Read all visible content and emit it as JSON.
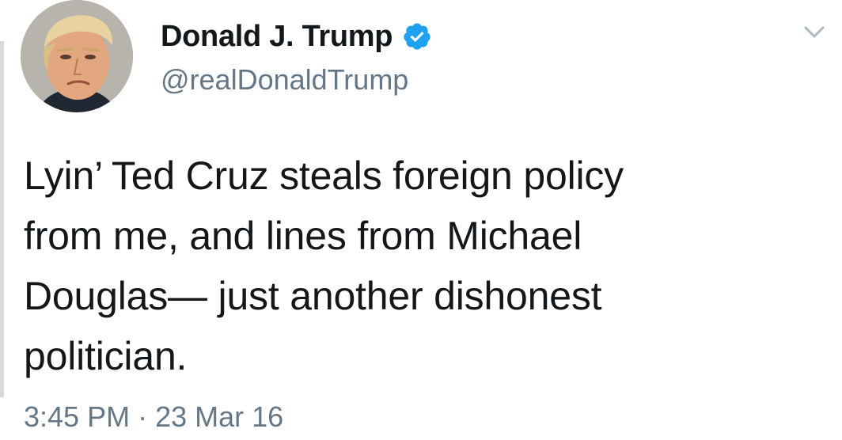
{
  "user": {
    "display_name": "Donald J. Trump",
    "handle": "@realDonaldTrump",
    "verified_icon": "verified-badge-icon",
    "avatar_icon": "profile-avatar"
  },
  "tweet": {
    "lines": [
      "Lyin’ Ted Cruz steals foreign policy",
      "from me, and lines from Michael",
      "Douglas— just another dishonest",
      "politician."
    ],
    "time": "3:45 PM",
    "separator": "·",
    "date": "23 Mar 16"
  },
  "menu": {
    "icon": "chevron-down-icon"
  },
  "colors": {
    "text": "#14171a",
    "secondary": "#657786",
    "verified": "#1da1f2",
    "chevron": "#aab8c2"
  }
}
